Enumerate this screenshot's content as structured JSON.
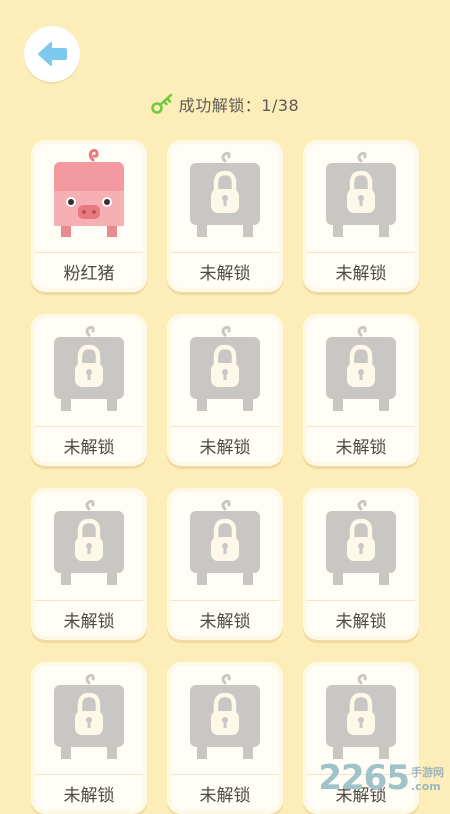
{
  "header": {
    "back_button_label": "back-arrow"
  },
  "status": {
    "icon": "key-icon",
    "text": "成功解锁：1/38"
  },
  "cards": [
    {
      "label": "粉红猪",
      "state": "unlocked"
    },
    {
      "label": "未解锁",
      "state": "locked"
    },
    {
      "label": "未解锁",
      "state": "locked"
    },
    {
      "label": "未解锁",
      "state": "locked"
    },
    {
      "label": "未解锁",
      "state": "locked"
    },
    {
      "label": "未解锁",
      "state": "locked"
    },
    {
      "label": "未解锁",
      "state": "locked"
    },
    {
      "label": "未解锁",
      "state": "locked"
    },
    {
      "label": "未解锁",
      "state": "locked"
    },
    {
      "label": "未解锁",
      "state": "locked"
    },
    {
      "label": "未解锁",
      "state": "locked"
    },
    {
      "label": "未解锁",
      "state": "locked"
    }
  ],
  "watermark": {
    "number": "2265",
    "cn": "手游网",
    "en": ".com"
  },
  "colors": {
    "background": "#FDEDB9",
    "back_arrow": "#7EC9EE",
    "key": "#6CCB3B",
    "pig": "#F29A9F",
    "locked": "#C9C7C4"
  }
}
